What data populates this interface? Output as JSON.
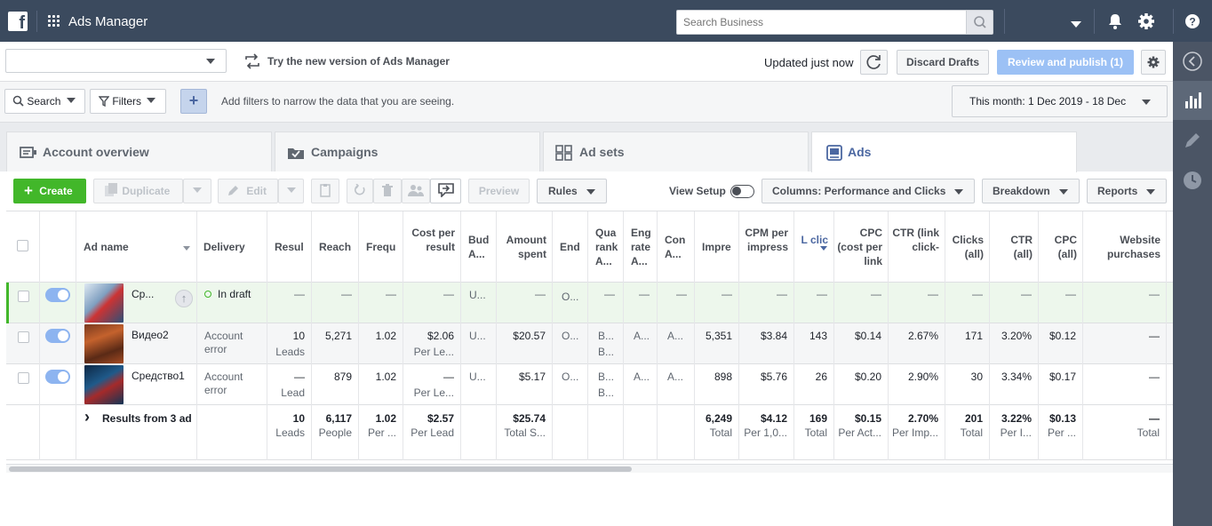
{
  "app": {
    "title": "Ads Manager",
    "search_placeholder": "Search Business"
  },
  "header": {
    "try_new": "Try the new version of Ads Manager",
    "updated": "Updated just now",
    "discard": "Discard Drafts",
    "review": "Review and publish (1)"
  },
  "filterbar": {
    "search": "Search",
    "filters": "Filters",
    "hint": "Add filters to narrow the data that you are seeing.",
    "date": "This month: 1 Dec 2019 - 18 Dec"
  },
  "tabs": [
    {
      "label": "Account overview",
      "icon": "account-overview-icon"
    },
    {
      "label": "Campaigns",
      "icon": "folder-icon"
    },
    {
      "label": "Ad sets",
      "icon": "grid-icon"
    },
    {
      "label": "Ads",
      "icon": "ad-icon"
    }
  ],
  "toolbar": {
    "create": "Create",
    "duplicate": "Duplicate",
    "edit": "Edit",
    "preview": "Preview",
    "rules": "Rules",
    "view_setup": "View Setup",
    "columns": "Columns: Performance and Clicks",
    "breakdown": "Breakdown",
    "reports": "Reports"
  },
  "columns": [
    "Ad name",
    "Delivery",
    "Resul",
    "Reach",
    "Frequ",
    "Cost per result",
    "Bud A...",
    "Amount spent",
    "End",
    "Qua rank A...",
    "Eng rate A...",
    "Con A...",
    "Impre",
    "CPM per impress",
    "L clic",
    "CPC (cost per link",
    "CTR (link click-",
    "Clicks (all)",
    "CTR (all)",
    "CPC (all)",
    "Website purchases"
  ],
  "rows": [
    {
      "name": "Ср...",
      "delivery": "In draft",
      "results": "—",
      "results_sub": "",
      "reach": "—",
      "freq": "—",
      "cost": "—",
      "cost_sub": "",
      "budget": "U...",
      "spent": "—",
      "end": "O...",
      "qual": "—",
      "qual2": "",
      "eng": "—",
      "conv": "—",
      "impr": "—",
      "cpm": "—",
      "link": "—",
      "cpc_link": "—",
      "ctr_link": "—",
      "clicks": "—",
      "ctr_all": "—",
      "cpc_all": "—",
      "purch": "—"
    },
    {
      "name": "Видео2",
      "delivery": "Account error",
      "results": "10",
      "results_sub": "Leads",
      "reach": "5,271",
      "freq": "1.02",
      "cost": "$2.06",
      "cost_sub": "Per Le...",
      "budget": "U...",
      "spent": "$20.57",
      "end": "O...",
      "qual": "B...",
      "qual2": "B...",
      "eng": "A...",
      "conv": "A...",
      "impr": "5,351",
      "cpm": "$3.84",
      "link": "143",
      "cpc_link": "$0.14",
      "ctr_link": "2.67%",
      "clicks": "171",
      "ctr_all": "3.20%",
      "cpc_all": "$0.12",
      "purch": "—"
    },
    {
      "name": "Средство1",
      "delivery": "Account error",
      "results": "—",
      "results_sub": "Lead",
      "reach": "879",
      "freq": "1.02",
      "cost": "—",
      "cost_sub": "Per Le...",
      "budget": "U...",
      "spent": "$5.17",
      "end": "O...",
      "qual": "B...",
      "qual2": "B...",
      "eng": "A...",
      "conv": "A...",
      "impr": "898",
      "cpm": "$5.76",
      "link": "26",
      "cpc_link": "$0.20",
      "ctr_link": "2.90%",
      "clicks": "30",
      "ctr_all": "3.34%",
      "cpc_all": "$0.17",
      "purch": "—"
    }
  ],
  "totals": {
    "label": "Results from 3 ad",
    "results": "10",
    "results_sub": "Leads",
    "reach": "6,117",
    "reach_sub": "People",
    "freq": "1.02",
    "freq_sub": "Per ...",
    "cost": "$2.57",
    "cost_sub": "Per Lead",
    "spent": "$25.74",
    "spent_sub": "Total S...",
    "impr": "6,249",
    "impr_sub": "Total",
    "cpm": "$4.12",
    "cpm_sub": "Per 1,0...",
    "link": "169",
    "link_sub": "Total",
    "cpc_link": "$0.15",
    "cpc_link_sub": "Per Act...",
    "ctr_link": "2.70%",
    "ctr_link_sub": "Per Imp...",
    "clicks": "201",
    "clicks_sub": "Total",
    "ctr_all": "3.22%",
    "ctr_all_sub": "Per I...",
    "cpc_all": "$0.13",
    "cpc_all_sub": "Per ...",
    "purch": "—",
    "purch_sub": "Total"
  },
  "colors": {
    "topbar": "#3b4a5e",
    "green": "#42b72a",
    "blue_link": "#4b67a1",
    "draft_row": "#edf7ec"
  }
}
